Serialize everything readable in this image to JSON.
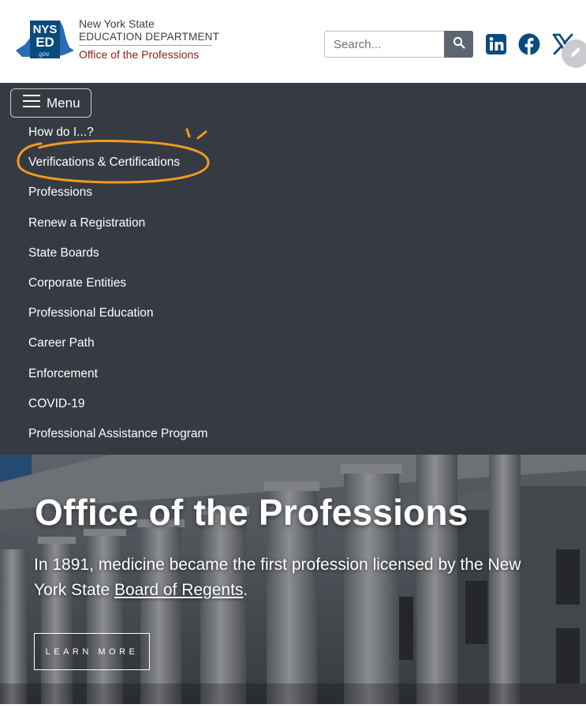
{
  "header": {
    "logo_badge": {
      "line1": "NYS",
      "line2": "ED",
      "line3": ".gov"
    },
    "logo_text": {
      "line1": "New York State",
      "line2": "EDUCATION DEPARTMENT",
      "line3": "Office of the Professions"
    },
    "search": {
      "placeholder": "Search..."
    },
    "social": [
      "linkedin-icon",
      "facebook-icon",
      "x-icon"
    ],
    "brand_blue": "#0b4a7c"
  },
  "nav": {
    "menu_label": "Menu",
    "items": [
      "How do I...?",
      "Verifications & Certifications",
      "Professions",
      "Renew a Registration",
      "State Boards",
      "Corporate Entities",
      "Professional Education",
      "Career Path",
      "Enforcement",
      "COVID-19",
      "Professional Assistance Program"
    ],
    "background": "#353a43",
    "annotation_color": "#f29a1f"
  },
  "hero": {
    "title": "Office of the Professions",
    "subtitle_before": "In 1891, medicine became the first profession licensed by the New York State ",
    "subtitle_link": "Board of Regents",
    "subtitle_after": ".",
    "button_label": "LEARN MORE"
  }
}
